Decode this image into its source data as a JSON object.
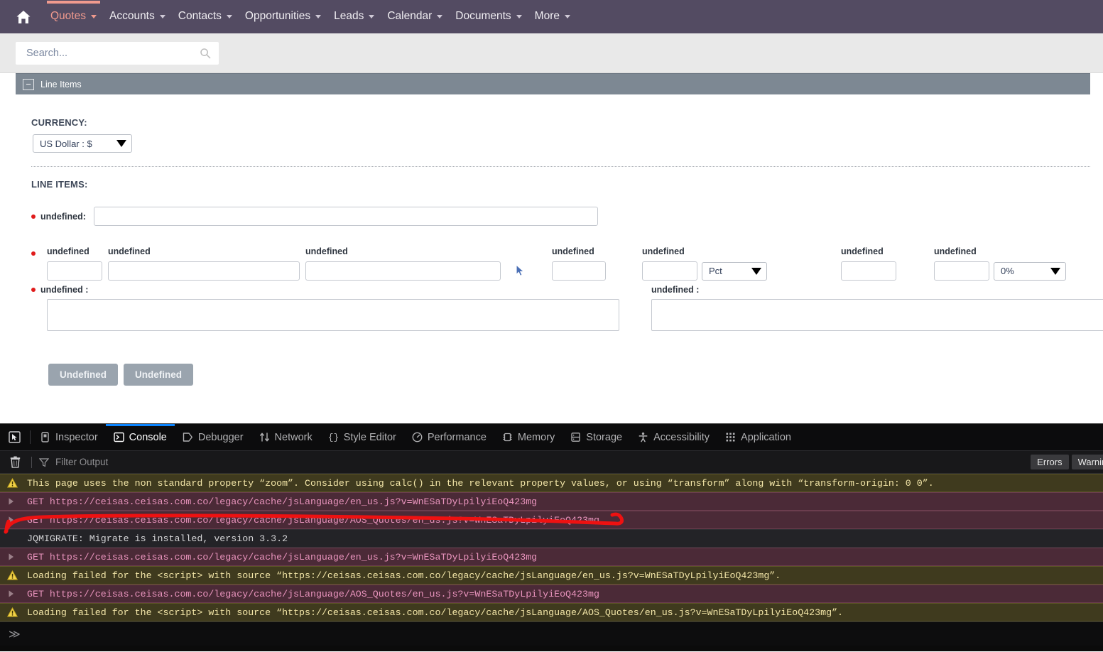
{
  "navbar": {
    "home_icon": "home-icon",
    "items": [
      {
        "label": "Quotes",
        "active": true
      },
      {
        "label": "Accounts",
        "active": false
      },
      {
        "label": "Contacts",
        "active": false
      },
      {
        "label": "Opportunities",
        "active": false
      },
      {
        "label": "Leads",
        "active": false
      },
      {
        "label": "Calendar",
        "active": false
      },
      {
        "label": "Documents",
        "active": false
      },
      {
        "label": "More",
        "active": false
      }
    ],
    "accent_color": "#f09a8e",
    "background_color": "#534b62"
  },
  "search": {
    "placeholder": "Search...",
    "value": "",
    "icon": "search-icon"
  },
  "panel": {
    "title": "Line Items",
    "collapse_symbol": "−",
    "header_color": "#7d8893"
  },
  "form": {
    "currency_label": "CURRENCY:",
    "currency_value": "US Dollar : $",
    "line_items_label": "LINE ITEMS:",
    "group_name_label": "undefined:",
    "group_name_value": "",
    "columns": [
      {
        "label": "undefined",
        "value": ""
      },
      {
        "label": "undefined",
        "value": ""
      },
      {
        "label": "undefined",
        "value": ""
      },
      {
        "label": "undefined",
        "value": ""
      },
      {
        "label": "undefined",
        "value": ""
      },
      {
        "label": "undefined",
        "value": ""
      },
      {
        "label": "undefined",
        "value": ""
      }
    ],
    "pct_select_value": "Pct",
    "percent_select_value": "0%",
    "description_label": "undefined :",
    "description_value": "",
    "group_description_label": "undefined :",
    "group_description_value": "",
    "buttons": [
      {
        "label": "Undefined"
      },
      {
        "label": "Undefined"
      }
    ]
  },
  "devtools": {
    "picker_icon": "element-picker-icon",
    "tabs": [
      {
        "label": "Inspector",
        "icon": "inspector-icon",
        "active": false
      },
      {
        "label": "Console",
        "icon": "console-icon",
        "active": true
      },
      {
        "label": "Debugger",
        "icon": "debugger-icon",
        "active": false
      },
      {
        "label": "Network",
        "icon": "network-icon",
        "active": false
      },
      {
        "label": "Style Editor",
        "icon": "style-editor-icon",
        "active": false
      },
      {
        "label": "Performance",
        "icon": "performance-icon",
        "active": false
      },
      {
        "label": "Memory",
        "icon": "memory-icon",
        "active": false
      },
      {
        "label": "Storage",
        "icon": "storage-icon",
        "active": false
      },
      {
        "label": "Accessibility",
        "icon": "accessibility-icon",
        "active": false
      },
      {
        "label": "Application",
        "icon": "application-icon",
        "active": false
      }
    ],
    "active_tab_color": "#0a84ff",
    "filter": {
      "trash_icon": "trash-icon",
      "funnel_icon": "funnel-icon",
      "placeholder": "Filter Output",
      "value": ""
    },
    "pills": [
      {
        "label": "Errors"
      },
      {
        "label": "Warnings"
      }
    ],
    "messages": [
      {
        "type": "warn",
        "icon": "warning-triangle-icon",
        "text": "This page uses the non standard property “zoom”. Consider using calc() in the relevant property values, or using “transform” along with “transform-origin: 0 0”."
      },
      {
        "type": "net",
        "icon": "expand-arrow-icon",
        "text": "GET https://ceisas.ceisas.com.co/legacy/cache/jsLanguage/en_us.js?v=WnESaTDyLpilyiEoQ423mg"
      },
      {
        "type": "net",
        "icon": "expand-arrow-icon",
        "text": "GET https://ceisas.ceisas.com.co/legacy/cache/jsLanguage/AOS_Quotes/en_us.js?v=WnESaTDyLpilyiEoQ423mg"
      },
      {
        "type": "info",
        "icon": "",
        "text": "JQMIGRATE: Migrate is installed, version 3.3.2"
      },
      {
        "type": "net",
        "icon": "expand-arrow-icon",
        "text": "GET https://ceisas.ceisas.com.co/legacy/cache/jsLanguage/en_us.js?v=WnESaTDyLpilyiEoQ423mg"
      },
      {
        "type": "warn",
        "icon": "warning-triangle-icon",
        "text": "Loading failed for the <script> with source “https://ceisas.ceisas.com.co/legacy/cache/jsLanguage/en_us.js?v=WnESaTDyLpilyiEoQ423mg”."
      },
      {
        "type": "net",
        "icon": "expand-arrow-icon",
        "text": "GET https://ceisas.ceisas.com.co/legacy/cache/jsLanguage/AOS_Quotes/en_us.js?v=WnESaTDyLpilyiEoQ423mg"
      },
      {
        "type": "warn",
        "icon": "warning-triangle-icon",
        "text": "Loading failed for the <script> with source “https://ceisas.ceisas.com.co/legacy/cache/jsLanguage/AOS_Quotes/en_us.js?v=WnESaTDyLpilyiEoQ423mg”."
      }
    ],
    "prompt_symbol": "≫"
  },
  "annotation": {
    "color": "#ee1111",
    "shape": "hand-drawn-underline-bracket"
  }
}
